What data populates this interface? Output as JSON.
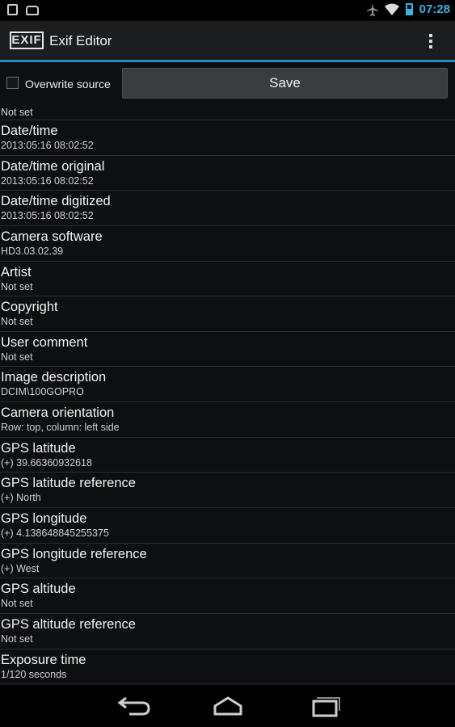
{
  "status_bar": {
    "time": "07:28",
    "icons": [
      "notification-box-icon",
      "android-icon",
      "airplane-icon",
      "wifi-icon",
      "battery-charging-icon"
    ]
  },
  "action_bar": {
    "logo_text": "EXIF",
    "title": "Exif Editor",
    "overflow_icon": "overflow-menu-icon"
  },
  "controls": {
    "overwrite_label": "Overwrite source",
    "overwrite_checked": false,
    "save_label": "Save"
  },
  "list": {
    "first_value": "Not set",
    "items": [
      {
        "label": "Date/time",
        "value": "2013:05:16 08:02:52"
      },
      {
        "label": "Date/time original",
        "value": "2013:05:16 08:02:52"
      },
      {
        "label": "Date/time digitized",
        "value": "2013:05:16 08:02:52"
      },
      {
        "label": "Camera software",
        "value": "HD3.03.02.39"
      },
      {
        "label": "Artist",
        "value": "Not set"
      },
      {
        "label": "Copyright",
        "value": "Not set"
      },
      {
        "label": "User comment",
        "value": "Not set"
      },
      {
        "label": "Image description",
        "value": "DCIM\\100GOPRO"
      },
      {
        "label": "Camera orientation",
        "value": "Row: top, column: left side"
      },
      {
        "label": "GPS latitude",
        "value": "(+) 39.66360932618"
      },
      {
        "label": "GPS latitude reference",
        "value": "(+) North"
      },
      {
        "label": "GPS longitude",
        "value": "(+) 4.138648845255375"
      },
      {
        "label": "GPS longitude reference",
        "value": "(+) West"
      },
      {
        "label": "GPS altitude",
        "value": "Not set"
      },
      {
        "label": "GPS altitude reference",
        "value": "Not set"
      },
      {
        "label": "Exposure time",
        "value": "1/120 seconds"
      }
    ]
  },
  "nav_bar": {
    "icons": [
      "back-icon",
      "home-icon",
      "recents-icon"
    ]
  },
  "colors": {
    "accent": "#33b5e5",
    "actionbar_divider": "#2a86c0",
    "background": "#0d0f10"
  }
}
